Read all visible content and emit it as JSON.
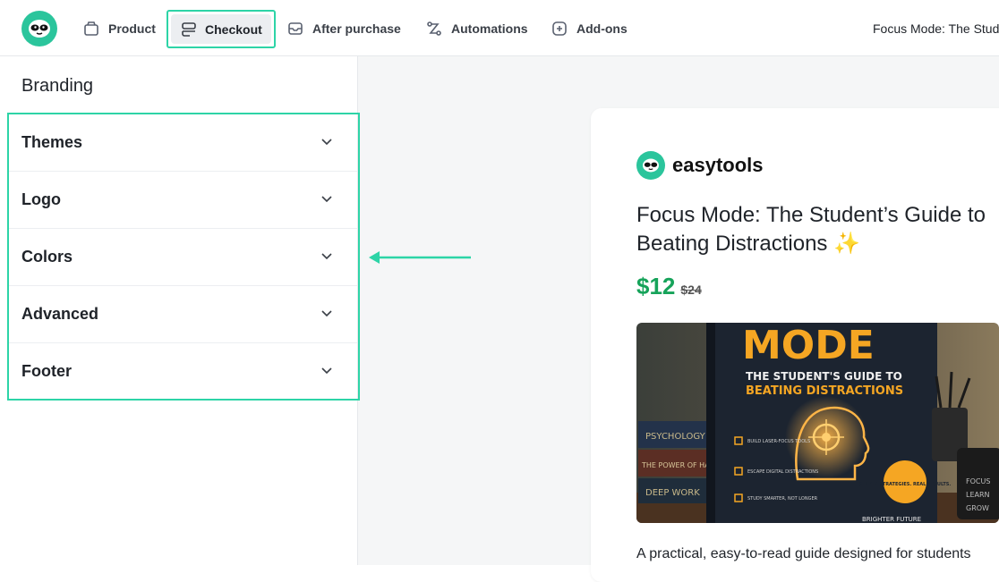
{
  "nav": {
    "items": [
      {
        "label": "Product",
        "icon": "box-icon"
      },
      {
        "label": "Checkout",
        "icon": "stack-icon",
        "active": true
      },
      {
        "label": "After purchase",
        "icon": "inbox-icon"
      },
      {
        "label": "Automations",
        "icon": "flow-icon"
      },
      {
        "label": "Add-ons",
        "icon": "plus-square-icon"
      }
    ],
    "product_title": "Focus Mode: The Stud"
  },
  "sidebar": {
    "heading": "Branding",
    "sections": [
      "Themes",
      "Logo",
      "Colors",
      "Advanced",
      "Footer"
    ]
  },
  "preview": {
    "brand": "easytools",
    "title": "Focus Mode: The Student’s Guide to Beating Distractions ✨",
    "price": "$12",
    "old_price": "$24",
    "description": "A practical, easy-to-read guide designed for students",
    "cover": {
      "word": "MODE",
      "subtitle_line1": "THE STUDENT'S GUIDE TO",
      "subtitle_line2": "BEATING DISTRACTIONS",
      "badge": "SIMPLE STRATEGIES. REAL RESULTS.",
      "books": [
        "PSYCHOLOGY",
        "THE POWER OF HABIT",
        "DEEP WORK"
      ],
      "mug": [
        "FOCUS",
        "LEARN",
        "GROW"
      ],
      "tips": [
        "BUILD LASER-FOCUS TOOLS",
        "ESCAPE DIGITAL DISTRACTIONS",
        "STUDY SMARTER, NOT LONGER"
      ],
      "footer": "BRIGHTER FUTURE"
    }
  },
  "colors": {
    "accent": "#2dd4a7",
    "brand": "#2bc59c",
    "price": "#16a35a"
  }
}
